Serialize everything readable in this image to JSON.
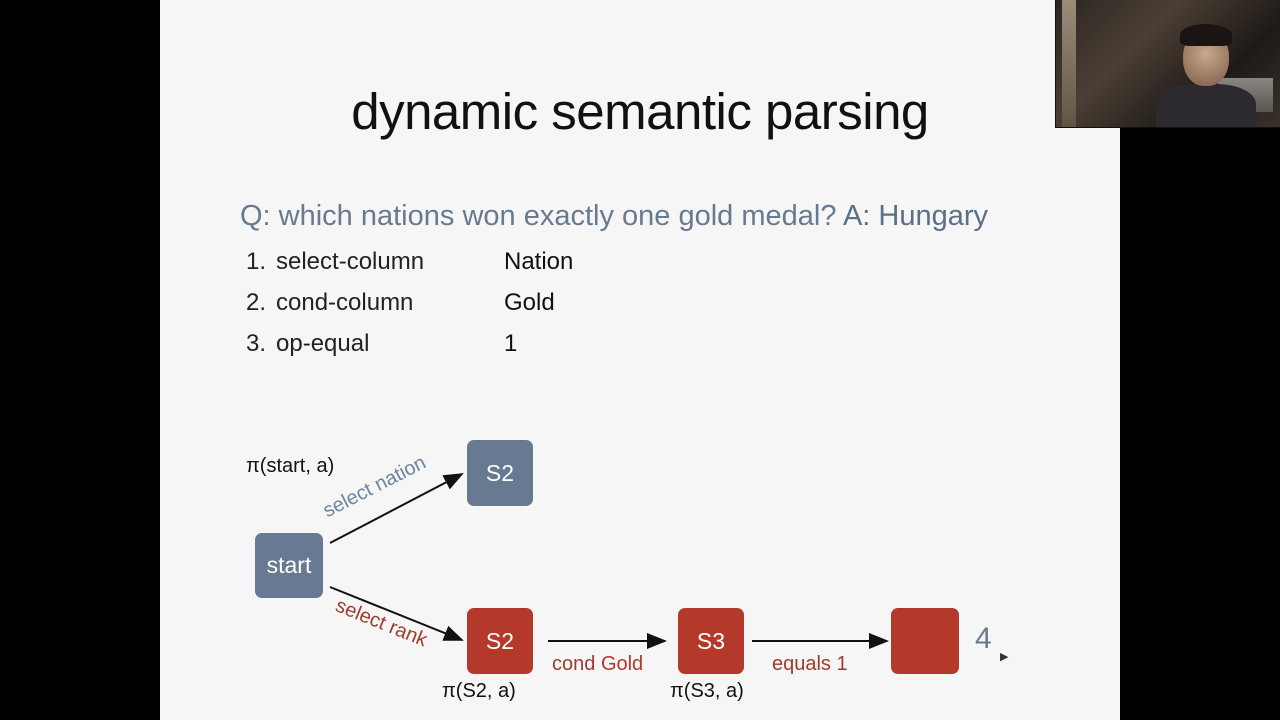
{
  "slide": {
    "title": "dynamic semantic parsing",
    "question": "Q: which nations won exactly one gold medal?",
    "answer": "A: Hungary",
    "steps": [
      {
        "num": "1.",
        "label": "select-column",
        "value": "Nation"
      },
      {
        "num": "2.",
        "label": "cond-column",
        "value": "Gold"
      },
      {
        "num": "3.",
        "label": "op-equal",
        "value": "1"
      }
    ]
  },
  "diagram": {
    "nodes": {
      "start": "start",
      "s2_top": "S2",
      "s2_bottom": "S2",
      "s3": "S3",
      "end": ""
    },
    "policy_labels": {
      "start": "π(start, a)",
      "s2": "π(S2, a)",
      "s3": "π(S3, a)"
    },
    "edge_labels": {
      "select_nation": "select nation",
      "select_rank": "select rank",
      "cond_prefix": "cond",
      "cond_gold": "Gold",
      "equals": "equals 1"
    },
    "result": "4"
  },
  "colors": {
    "blue_node": "#687a91",
    "red_node": "#b5392a",
    "slide_bg": "#f6f6f6"
  }
}
